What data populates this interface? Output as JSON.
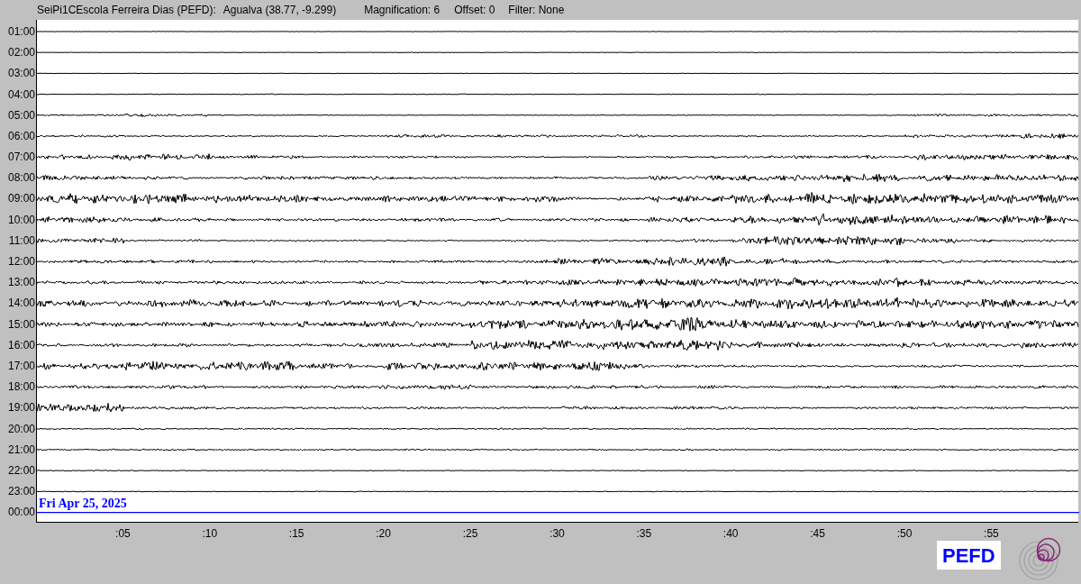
{
  "header": {
    "station": "SeiPi1CEscola Ferreira Dias (PEFD):",
    "location": "Agualva (38.77, -9.299)",
    "magnification": "Magnification: 6",
    "offset": "Offset: 0",
    "filter": "Filter: None"
  },
  "rows": [
    "01:00",
    "02:00",
    "03:00",
    "04:00",
    "05:00",
    "06:00",
    "07:00",
    "08:00",
    "09:00",
    "10:00",
    "11:00",
    "12:00",
    "13:00",
    "14:00",
    "15:00",
    "16:00",
    "17:00",
    "18:00",
    "19:00",
    "20:00",
    "21:00",
    "22:00",
    "23:00",
    "00:00"
  ],
  "date_label": "Fri Apr 25, 2025",
  "x_ticks": [
    ":05",
    ":10",
    ":15",
    ":20",
    ":25",
    ":30",
    ":35",
    ":40",
    ":45",
    ":50",
    ":55"
  ],
  "logo_text": "PEFD"
}
